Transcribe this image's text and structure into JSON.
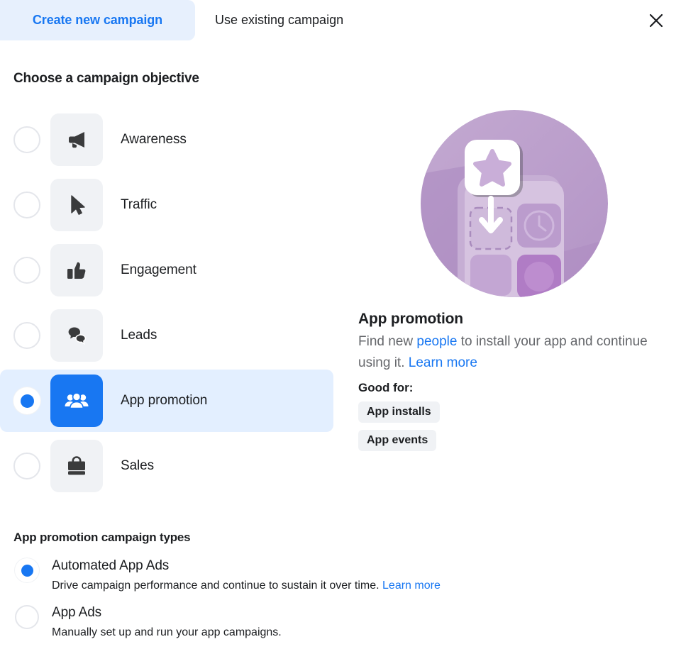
{
  "tabs": [
    {
      "label": "Create new campaign",
      "active": true,
      "name": "tab-create-new-campaign"
    },
    {
      "label": "Use existing campaign",
      "active": false,
      "name": "tab-use-existing-campaign"
    }
  ],
  "close_icon": "close-icon",
  "objective_section": {
    "title": "Choose a campaign objective",
    "items": [
      {
        "label": "Awareness",
        "icon": "megaphone-icon",
        "selected": false
      },
      {
        "label": "Traffic",
        "icon": "cursor-arrow-icon",
        "selected": false
      },
      {
        "label": "Engagement",
        "icon": "thumbs-up-icon",
        "selected": false
      },
      {
        "label": "Leads",
        "icon": "speech-bubbles-icon",
        "selected": false
      },
      {
        "label": "App promotion",
        "icon": "people-group-icon",
        "selected": true
      },
      {
        "label": "Sales",
        "icon": "shopping-bag-icon",
        "selected": false
      }
    ]
  },
  "detail": {
    "illustration": "app-install-illustration",
    "title": "App promotion",
    "description_part1": "Find new ",
    "description_link1": "people",
    "description_part2": " to install your app and continue using it. ",
    "description_link2": "Learn more",
    "good_for_label": "Good for:",
    "chips": [
      "App installs",
      "App events"
    ]
  },
  "campaign_types": {
    "title": "App promotion campaign types",
    "items": [
      {
        "name": "Automated App Ads",
        "description": "Drive campaign performance and continue to sustain it over time. ",
        "link": "Learn more",
        "selected": true
      },
      {
        "name": "App Ads",
        "description": "Manually set up and run your app campaigns.",
        "link": "",
        "selected": false
      }
    ]
  },
  "colors": {
    "brand_blue": "#1877f2",
    "tab_active_bg": "#e7f0fd",
    "row_selected_bg": "#e3efff",
    "tile_bg": "#f0f2f5",
    "text_primary": "#1c1e21",
    "text_secondary": "#65676b",
    "illustration_purple": "#b89cc8"
  }
}
